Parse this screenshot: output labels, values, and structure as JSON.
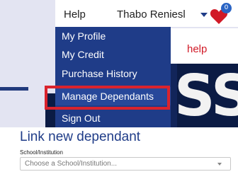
{
  "header": {
    "help_label": "Help",
    "user_name": "Thabo Reniesl",
    "cart_count": "0"
  },
  "background": {
    "help_text": "help",
    "banner_letters": [
      "S",
      "S"
    ]
  },
  "menu": {
    "items": [
      {
        "label": "My Profile"
      },
      {
        "label": "My Credit"
      },
      {
        "label": "Purchase History"
      },
      {
        "label": "Manage Dependants"
      },
      {
        "label": "Sign Out"
      }
    ]
  },
  "form": {
    "title": "Link new dependant",
    "field_label": "School/Institution",
    "select_placeholder": "Choose a School/Institution..."
  },
  "colors": {
    "brand_blue": "#1f3c88",
    "highlight_red": "#d9232d",
    "heart_red": "#d11a27",
    "badge_blue": "#2a64c4"
  }
}
